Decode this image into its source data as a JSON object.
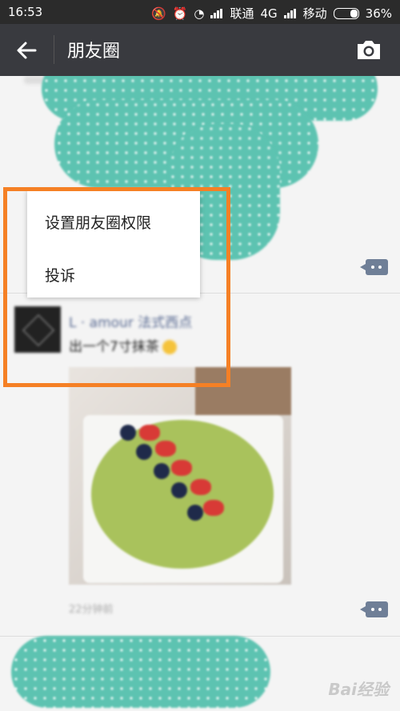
{
  "status_bar": {
    "time": "16:53",
    "carrier1": "联通",
    "network": "4G",
    "carrier2": "移动",
    "battery": "36%"
  },
  "nav": {
    "title": "朋友圈",
    "back_icon": "back-arrow-icon",
    "camera_icon": "camera-icon"
  },
  "popup_menu": {
    "items": [
      {
        "label": "设置朋友圈权限"
      },
      {
        "label": "投诉"
      }
    ]
  },
  "post": {
    "author": "L · amour 法式西点",
    "text": "出一个7寸抹茶",
    "time": "22分钟前"
  },
  "watermark": "Bai经验",
  "colors": {
    "nav_bg": "#393a3f",
    "highlight": "#f58025",
    "mask": "#5dc3b1",
    "link": "#5a6b93"
  }
}
